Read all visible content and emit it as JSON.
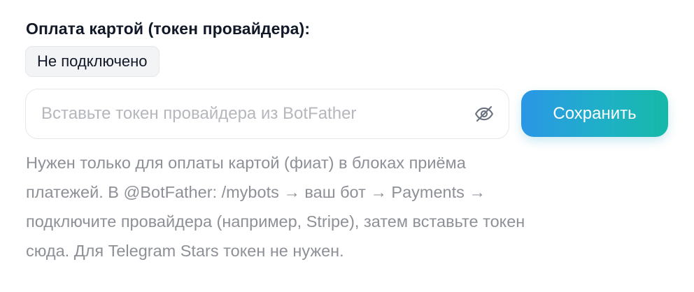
{
  "card_payment": {
    "label": "Оплата картой (токен провайдера):",
    "status": "Не подключено",
    "token_input": {
      "value": "",
      "placeholder": "Вставьте токен провайдера из BotFather",
      "toggle_icon": "eye-off-icon"
    },
    "save_label": "Сохранить",
    "hint_lines": [
      "Нужен только для оплаты картой (фиат) в блоках приёма",
      "платежей. В @BotFather: /mybots → ваш бот → Payments →",
      "подключите провайдера (например, Stripe), затем вставьте токен",
      "сюда. Для Telegram Stars токен не нужен."
    ]
  },
  "colors": {
    "label": "#111827",
    "badge_bg": "#f3f4f6",
    "badge_border": "#e5e7eb",
    "placeholder": "#b5b7bd",
    "hint": "#8d9097",
    "button_gradient_start": "#2b96e6",
    "button_gradient_end": "#16b9a8",
    "button_text": "#ffffff"
  }
}
